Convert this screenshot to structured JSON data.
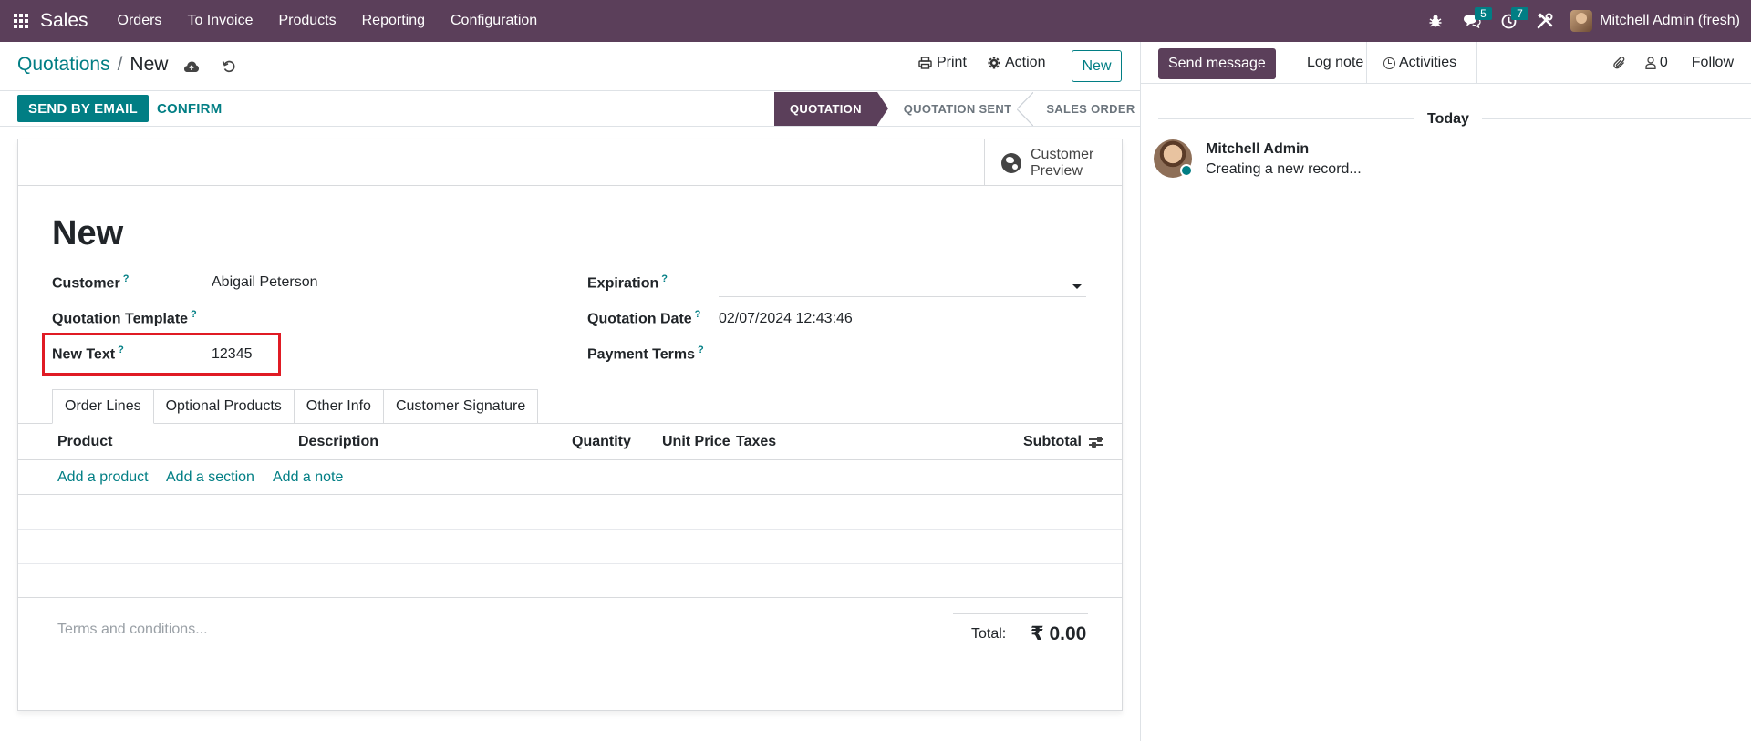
{
  "navbar": {
    "app_name": "Sales",
    "menu": [
      "Orders",
      "To Invoice",
      "Products",
      "Reporting",
      "Configuration"
    ],
    "messages_count": "5",
    "activities_count": "7",
    "user_name": "Mitchell Admin (fresh)"
  },
  "control_panel": {
    "breadcrumb_parent": "Quotations",
    "breadcrumb_current": "New",
    "print_label": "Print",
    "action_label": "Action",
    "new_label": "New"
  },
  "statusbar": {
    "send_email_label": "SEND BY EMAIL",
    "confirm_label": "CONFIRM",
    "stages": [
      "QUOTATION",
      "QUOTATION SENT",
      "SALES ORDER"
    ],
    "active_stage": "QUOTATION"
  },
  "form": {
    "customer_preview_label": "Customer Preview",
    "title": "New",
    "fields": {
      "customer_label": "Customer",
      "customer_value": "Abigail Peterson",
      "template_label": "Quotation Template",
      "template_value": "",
      "new_text_label": "New Text",
      "new_text_value": "12345",
      "expiration_label": "Expiration",
      "expiration_value": "",
      "date_label": "Quotation Date",
      "date_value": "02/07/2024 12:43:46",
      "payment_terms_label": "Payment Terms",
      "payment_terms_value": ""
    },
    "help_marker": "?",
    "tabs": [
      "Order Lines",
      "Optional Products",
      "Other Info",
      "Customer Signature"
    ],
    "active_tab": "Order Lines",
    "columns": [
      "Product",
      "Description",
      "Quantity",
      "Unit Price",
      "Taxes",
      "Subtotal"
    ],
    "add_links": [
      "Add a product",
      "Add a section",
      "Add a note"
    ],
    "terms_placeholder": "Terms and conditions...",
    "total_label": "Total:",
    "total_value": "₹ 0.00"
  },
  "chatter": {
    "send_message_label": "Send message",
    "log_note_label": "Log note",
    "activities_label": "Activities",
    "followers_count": "0",
    "follow_label": "Follow",
    "date_separator": "Today",
    "message_author": "Mitchell Admin",
    "message_body": "Creating a new record..."
  },
  "colors": {
    "brand": "#5b3f5a",
    "accent": "#017e84",
    "highlight": "#e01b24"
  }
}
